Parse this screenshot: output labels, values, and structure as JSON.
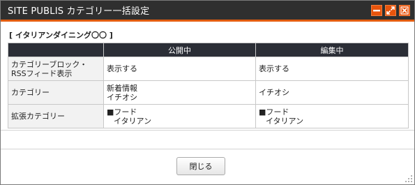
{
  "window": {
    "title": "SITE PUBLIS カテゴリー一括設定",
    "icons": [
      "minimize-icon",
      "maximize-icon",
      "close-icon"
    ],
    "accent_color": "#e8540c",
    "titlebar_color": "#2f2f2f"
  },
  "section": {
    "label": "[ イタリアンダイニング〇〇 ]"
  },
  "table": {
    "headers": [
      "",
      "公開中",
      "編集中"
    ],
    "rows": [
      {
        "label_line1": "カテゴリーブロック・",
        "label_line2": "RSSフィード表示",
        "published": "表示する",
        "editing": "表示する"
      },
      {
        "label": "カテゴリー",
        "published_line1": "新着情報",
        "published_line2": "イチオシ",
        "editing": "イチオシ"
      },
      {
        "label": "拡張カテゴリー",
        "published_line1": "■フード",
        "published_line2": "イタリアン",
        "editing_line1": "■フード",
        "editing_line2": "イタリアン"
      }
    ]
  },
  "footer": {
    "close_label": "閉じる"
  }
}
